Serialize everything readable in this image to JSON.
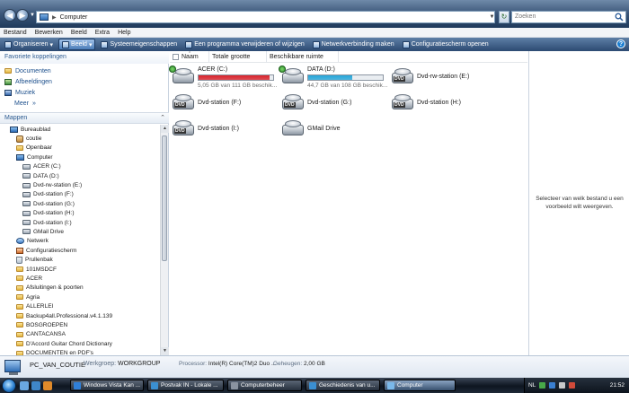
{
  "address_bar": {
    "location": "Computer",
    "search_placeholder": "Zoeken"
  },
  "menu": [
    "Bestand",
    "Bewerken",
    "Beeld",
    "Extra",
    "Help"
  ],
  "toolbar": {
    "organize": "Organiseren",
    "views": "Beeld",
    "system_properties": "Systeemeigenschappen",
    "uninstall": "Een programma verwijderen of wijzigen",
    "map_drive": "Netwerkverbinding maken",
    "control_panel": "Configuratiescherm openen"
  },
  "navigation": {
    "favorites_header": "Favoriete koppelingen",
    "favorites": [
      "Documenten",
      "Afbeeldingen",
      "Muziek"
    ],
    "more": "Meer",
    "folders_header": "Mappen",
    "tree": [
      {
        "label": "Bureaublad",
        "indent": 1,
        "icon": "desktop"
      },
      {
        "label": "coutie",
        "indent": 2,
        "icon": "user"
      },
      {
        "label": "Openbaar",
        "indent": 2,
        "icon": "folder"
      },
      {
        "label": "Computer",
        "indent": 2,
        "icon": "computer"
      },
      {
        "label": "ACER (C:)",
        "indent": 3,
        "icon": "disk"
      },
      {
        "label": "DATA (D:)",
        "indent": 3,
        "icon": "disk"
      },
      {
        "label": "Dvd-rw-station (E:)",
        "indent": 3,
        "icon": "disk"
      },
      {
        "label": "Dvd-station (F:)",
        "indent": 3,
        "icon": "disk"
      },
      {
        "label": "Dvd-station (G:)",
        "indent": 3,
        "icon": "disk"
      },
      {
        "label": "Dvd-station (H:)",
        "indent": 3,
        "icon": "disk"
      },
      {
        "label": "Dvd-station (I:)",
        "indent": 3,
        "icon": "disk"
      },
      {
        "label": "GMail Drive",
        "indent": 3,
        "icon": "disk"
      },
      {
        "label": "Netwerk",
        "indent": 2,
        "icon": "network"
      },
      {
        "label": "Configuratiescherm",
        "indent": 2,
        "icon": "controlpanel"
      },
      {
        "label": "Prullenbak",
        "indent": 2,
        "icon": "recyclebin"
      },
      {
        "label": "101MSDCF",
        "indent": 2,
        "icon": "folder"
      },
      {
        "label": "ACER",
        "indent": 2,
        "icon": "folder"
      },
      {
        "label": "Afsluitingen & poorten",
        "indent": 2,
        "icon": "folder"
      },
      {
        "label": "Agria",
        "indent": 2,
        "icon": "folder"
      },
      {
        "label": "ALLERLEI",
        "indent": 2,
        "icon": "folder"
      },
      {
        "label": "Backup4all.Professional.v4.1.139",
        "indent": 2,
        "icon": "folder"
      },
      {
        "label": "BOSGROEPEN",
        "indent": 2,
        "icon": "folder"
      },
      {
        "label": "CANTACANSA",
        "indent": 2,
        "icon": "folder"
      },
      {
        "label": "D'Accord Guitar Chord Dictionary",
        "indent": 2,
        "icon": "folder"
      },
      {
        "label": "DOCUMENTEN en PDF's",
        "indent": 2,
        "icon": "folder"
      }
    ]
  },
  "columns": [
    "Naam",
    "Totale grootte",
    "Beschikbare ruimte"
  ],
  "drives": [
    {
      "name": "ACER (C:)",
      "type": "hdd",
      "system": true,
      "free_text": "5,05 GB van 111 GB beschik...",
      "used_fraction": 0.955,
      "bar_color": "#d9242c"
    },
    {
      "name": "DATA (D:)",
      "type": "hdd",
      "system": true,
      "free_text": "44,7 GB van 108 GB beschik...",
      "used_fraction": 0.586,
      "bar_color": "#27a6d8"
    },
    {
      "name": "Dvd-rw-station (E:)",
      "type": "dvd"
    },
    {
      "name": "Dvd-station (F:)",
      "type": "dvd"
    },
    {
      "name": "Dvd-station (G:)",
      "type": "dvd"
    },
    {
      "name": "Dvd-station (H:)",
      "type": "dvd"
    },
    {
      "name": "Dvd-station (I:)",
      "type": "dvd"
    },
    {
      "name": "GMail Drive",
      "type": "hdd"
    }
  ],
  "preview": {
    "text": "Selecteer van welk bestand u een voorbeeld wilt weergeven."
  },
  "details": {
    "computer_name": "PC_VAN_COUTIE",
    "workgroup_label": "Werkgroep:",
    "workgroup": "WORKGROUP",
    "cpu_label": "Processor:",
    "cpu": "Intel(R) Core(TM)2 Duo ...",
    "memory_label": "Geheugen:",
    "memory": "2,00 GB"
  },
  "taskbar": {
    "tasks": [
      {
        "label": "Windows Vista Kan ...",
        "color": "#2f7fd8"
      },
      {
        "label": "Postvak IN - Lokale ...",
        "color": "#3b8fd1"
      },
      {
        "label": "Computerbeheer",
        "color": "#8a93a0"
      },
      {
        "label": "Geschiedenis van u...",
        "color": "#3b8fd1"
      },
      {
        "label": "Computer",
        "color": "#7ab8ea",
        "active": true
      }
    ],
    "language": "NL",
    "clock": "21:52"
  },
  "colors": {
    "accent": "#2e5c91",
    "link": "#1c4f8c"
  }
}
